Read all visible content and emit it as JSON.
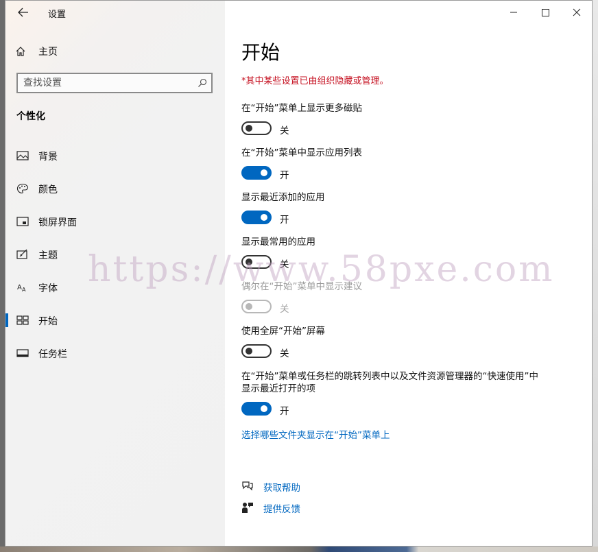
{
  "window": {
    "title": "设置"
  },
  "sidebar": {
    "home_label": "主页",
    "search": {
      "placeholder": "查找设置"
    },
    "section": "个性化",
    "items": [
      {
        "label": "背景",
        "icon": "picture-icon",
        "selected": false
      },
      {
        "label": "颜色",
        "icon": "palette-icon",
        "selected": false
      },
      {
        "label": "锁屏界面",
        "icon": "lockscreen-icon",
        "selected": false
      },
      {
        "label": "主题",
        "icon": "theme-icon",
        "selected": false
      },
      {
        "label": "字体",
        "icon": "font-icon",
        "selected": false
      },
      {
        "label": "开始",
        "icon": "start-icon",
        "selected": true
      },
      {
        "label": "任务栏",
        "icon": "taskbar-icon",
        "selected": false
      }
    ]
  },
  "main": {
    "title": "开始",
    "org_note": "*其中某些设置已由组织隐藏或管理。",
    "settings": [
      {
        "label": "在“开始”菜单上显示更多磁贴",
        "state": "关",
        "on": false,
        "enabled": true
      },
      {
        "label": "在“开始”菜单中显示应用列表",
        "state": "开",
        "on": true,
        "enabled": true
      },
      {
        "label": "显示最近添加的应用",
        "state": "开",
        "on": true,
        "enabled": true
      },
      {
        "label": "显示最常用的应用",
        "state": "关",
        "on": false,
        "enabled": true
      },
      {
        "label": "偶尔在“开始”菜单中显示建议",
        "state": "关",
        "on": false,
        "enabled": false
      },
      {
        "label": "使用全屏“开始”屏幕",
        "state": "关",
        "on": false,
        "enabled": true
      },
      {
        "label_line1": "在“开始”菜单或任务栏的跳转列表中以及文件资源管理器的“快速使用”中",
        "label_line2": "显示最近打开的项",
        "state": "开",
        "on": true,
        "enabled": true
      }
    ],
    "folders_link": "选择哪些文件夹显示在“开始”菜单上",
    "help": {
      "get_help": "获取帮助",
      "feedback": "提供反馈"
    }
  },
  "watermark": "https://www.58pxe.com",
  "colors": {
    "accent": "#0067c0",
    "warning": "#c50f1f"
  }
}
